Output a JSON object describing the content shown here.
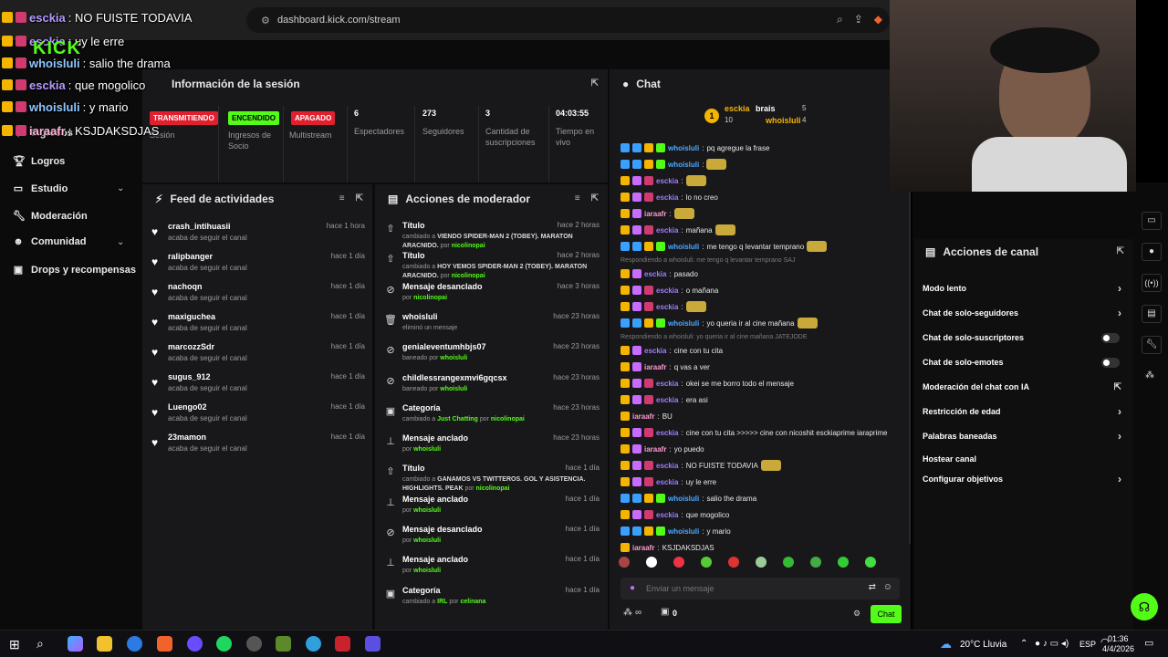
{
  "browser": {
    "url": "dashboard.kick.com/stream"
  },
  "overlay": {
    "lines": [
      {
        "user": "esckia",
        "text": ": NO FUISTE TODAVIA"
      },
      {
        "user": "esckia",
        "text": ": uy le erre"
      },
      {
        "user": "whoisluli",
        "text": ": salio the drama"
      },
      {
        "user": "esckia",
        "text": ": que mogolico"
      },
      {
        "user": "whoisluli",
        "text": ": y mario"
      },
      {
        "user": "iaraafr",
        "text": ": KSJDAKSDJAS"
      }
    ],
    "logo": "KICK"
  },
  "sidebar": {
    "items": [
      {
        "label": "Ingresos",
        "icon": "dollar-icon"
      },
      {
        "label": "Logros",
        "icon": "trophy-icon"
      },
      {
        "label": "Estudio",
        "icon": "studio-icon"
      },
      {
        "label": "Moderación",
        "icon": "wrench-icon"
      },
      {
        "label": "Comunidad",
        "icon": "people-icon"
      },
      {
        "label": "Drops y recompensas",
        "icon": "gift-icon"
      }
    ]
  },
  "session": {
    "title": "Información de la sesión",
    "stats": [
      {
        "badge": "TRANSMITIENDO",
        "label": "Sesión"
      },
      {
        "badge": "ENCENDIDO",
        "label": "Ingresos de Socio"
      },
      {
        "badge": "APAGADO",
        "label": "Multistream"
      },
      {
        "value": "6",
        "label": "Espectadores"
      },
      {
        "value": "273",
        "label": "Seguidores"
      },
      {
        "value": "3",
        "label": "Cantidad de suscripciones"
      },
      {
        "value": "04:03:55",
        "label": "Tiempo en vivo"
      }
    ]
  },
  "feed": {
    "title": "Feed de actividades",
    "items": [
      {
        "name": "crash_intihuasii",
        "sub": "acaba de seguir el canal",
        "time": "hace 1 hora"
      },
      {
        "name": "ralipbanger",
        "sub": "acaba de seguir el canal",
        "time": "hace 1 día"
      },
      {
        "name": "nachoqn",
        "sub": "acaba de seguir el canal",
        "time": "hace 1 día"
      },
      {
        "name": "maxiguchea",
        "sub": "acaba de seguir el canal",
        "time": "hace 1 día"
      },
      {
        "name": "marcozzSdr",
        "sub": "acaba de seguir el canal",
        "time": "hace 1 día"
      },
      {
        "name": "sugus_912",
        "sub": "acaba de seguir el canal",
        "time": "hace 1 día"
      },
      {
        "name": "Luengo02",
        "sub": "acaba de seguir el canal",
        "time": "hace 1 día"
      },
      {
        "name": "23mamon",
        "sub": "acaba de seguir el canal",
        "time": "hace 1 día"
      }
    ]
  },
  "modactions": {
    "title": "Acciones de moderador",
    "items": [
      {
        "icon": "title-icon",
        "name": "Título",
        "pre": "cambiado a ",
        "bold": "VIENDO SPIDER-MAN 2 (TOBEY). MARATON ARACNIDO.",
        "mid": " por ",
        "user": "nicolinopai",
        "time": "hace 2 horas"
      },
      {
        "icon": "title-icon",
        "name": "Título",
        "pre": "cambiado a ",
        "bold": "HOY VEMOS SPIDER-MAN 2 (TOBEY). MARATON ARACNIDO.",
        "mid": " por ",
        "user": "nicolinopai",
        "time": "hace 2 horas"
      },
      {
        "icon": "unpin-icon",
        "name": "Mensaje desanclado",
        "pre": "por ",
        "bold": "",
        "mid": "",
        "user": "nicolinopai",
        "time": "hace 3 horas"
      },
      {
        "icon": "trash-icon",
        "name": "whoisluli",
        "pre": "eliminó un mensaje",
        "bold": "",
        "mid": "",
        "user": "",
        "time": "hace 23 horas"
      },
      {
        "icon": "ban-icon",
        "name": "genialeventumhbjs07",
        "pre": "baneado por ",
        "bold": "",
        "mid": "",
        "user": "whoisluli",
        "time": "hace 23 horas"
      },
      {
        "icon": "ban-icon",
        "name": "childlessrangexmvi6gqcsx",
        "pre": "baneado por ",
        "bold": "",
        "mid": "",
        "user": "whoisluli",
        "time": "hace 23 horas"
      },
      {
        "icon": "category-icon",
        "name": "Categoría",
        "pre": "cambiado a ",
        "bold": "",
        "mid": " por ",
        "user": "nicolinopai",
        "green": "Just Chatting",
        "time": "hace 23 horas"
      },
      {
        "icon": "pin-icon",
        "name": "Mensaje anclado",
        "pre": "por ",
        "bold": "",
        "mid": "",
        "user": "whoisluli",
        "time": "hace 23 horas"
      },
      {
        "icon": "title-icon",
        "name": "Título",
        "pre": "cambiado a ",
        "bold": "GANAMOS VS TWITTEROS. GOL Y ASISTENCIA. HIGHLIGHTS. PEAK",
        "mid": " por ",
        "user": "nicolinopai",
        "time": "hace 1 día"
      },
      {
        "icon": "pin-icon",
        "name": "Mensaje anclado",
        "pre": "por ",
        "bold": "",
        "mid": "",
        "user": "whoisluli",
        "time": "hace 1 día"
      },
      {
        "icon": "unpin-icon",
        "name": "Mensaje desanclado",
        "pre": "por ",
        "bold": "",
        "mid": "",
        "user": "whoisluli",
        "time": "hace 1 día"
      },
      {
        "icon": "pin-icon",
        "name": "Mensaje anclado",
        "pre": "por ",
        "bold": "",
        "mid": "",
        "user": "whoisluli",
        "time": "hace 1 día"
      },
      {
        "icon": "category-icon",
        "name": "Categoría",
        "pre": "cambiado a ",
        "bold": "",
        "mid": " por ",
        "user": "celinana",
        "green": "IRL",
        "time": "hace 1 día"
      }
    ]
  },
  "chat": {
    "title": "Chat",
    "top": [
      {
        "rank": "1",
        "user": "esckia",
        "count": "10"
      },
      {
        "user": "brais",
        "count": "5"
      },
      {
        "user": "whoisluli",
        "count": "4"
      }
    ],
    "messages": [
      {
        "user": "whoisluli",
        "ucolor": "#4aa8ff",
        "text": "pq agregue la frase",
        "badges": [
          "#3aa0ff",
          "#3aa0ff",
          "#f5b400",
          "#53fc18"
        ]
      },
      {
        "user": "whoisluli",
        "ucolor": "#4aa8ff",
        "text": "",
        "badges": [
          "#3aa0ff",
          "#3aa0ff",
          "#f5b400",
          "#53fc18"
        ],
        "emote": true
      },
      {
        "user": "esckia",
        "ucolor": "#a07cff",
        "text": "",
        "badges": [
          "#f5b400",
          "#c86bff",
          "#d03a6f"
        ],
        "emote": true
      },
      {
        "user": "esckia",
        "ucolor": "#a07cff",
        "text": "lo no creo",
        "badges": [
          "#f5b400",
          "#c86bff",
          "#d03a6f"
        ]
      },
      {
        "user": "iaraafr",
        "ucolor": "#ff9bd0",
        "text": "",
        "badges": [
          "#f5b400",
          "#c86bff"
        ],
        "emote": true
      },
      {
        "user": "esckia",
        "ucolor": "#a07cff",
        "text": "mañana",
        "badges": [
          "#f5b400",
          "#c86bff",
          "#d03a6f"
        ],
        "emote": true
      },
      {
        "user": "whoisluli",
        "ucolor": "#4aa8ff",
        "text": "me tengo q levantar temprano",
        "badges": [
          "#3aa0ff",
          "#3aa0ff",
          "#f5b400",
          "#53fc18"
        ],
        "emote": true
      },
      {
        "reply": "Respondiendo a whoisluli: me tengo q levantar temprano SAJ"
      },
      {
        "user": "esckia",
        "ucolor": "#a07cff",
        "text": "pasado",
        "badges": [
          "#f5b400",
          "#c86bff"
        ]
      },
      {
        "user": "esckia",
        "ucolor": "#a07cff",
        "text": "o mañana",
        "badges": [
          "#f5b400",
          "#c86bff",
          "#d03a6f"
        ]
      },
      {
        "user": "esckia",
        "ucolor": "#a07cff",
        "text": "",
        "badges": [
          "#f5b400",
          "#c86bff",
          "#d03a6f"
        ],
        "emote": true
      },
      {
        "user": "whoisluli",
        "ucolor": "#4aa8ff",
        "text": "yo queria ir al cine mañana",
        "badges": [
          "#3aa0ff",
          "#3aa0ff",
          "#f5b400",
          "#53fc18"
        ],
        "emote": true
      },
      {
        "reply": "Respondiendo a whoisluli: yo queria ir al cine mañana JATEJODE"
      },
      {
        "user": "esckia",
        "ucolor": "#a07cff",
        "text": "cine con tu cita",
        "badges": [
          "#f5b400",
          "#c86bff"
        ]
      },
      {
        "user": "iaraafr",
        "ucolor": "#ff9bd0",
        "text": "q vas a ver",
        "badges": [
          "#f5b400",
          "#c86bff"
        ]
      },
      {
        "user": "esckia",
        "ucolor": "#a07cff",
        "text": "okei se me borro todo el mensaje",
        "badges": [
          "#f5b400",
          "#c86bff",
          "#d03a6f"
        ]
      },
      {
        "user": "esckia",
        "ucolor": "#a07cff",
        "text": "era asi",
        "badges": [
          "#f5b400",
          "#c86bff",
          "#d03a6f"
        ]
      },
      {
        "user": "iaraafr",
        "ucolor": "#ff9bd0",
        "text": "BU",
        "badges": [
          "#f5b400"
        ]
      },
      {
        "user": "esckia",
        "ucolor": "#a07cff",
        "text": "cine con tu cita >>>>> cine con nicoshit esckiaprime iaraprime",
        "badges": [
          "#f5b400",
          "#c86bff",
          "#d03a6f"
        ]
      },
      {
        "user": "iaraafr",
        "ucolor": "#ff9bd0",
        "text": "yo puedo",
        "badges": [
          "#f5b400",
          "#c86bff"
        ]
      },
      {
        "user": "esckia",
        "ucolor": "#a07cff",
        "text": "NO FUISTE TODAVIA",
        "badges": [
          "#f5b400",
          "#c86bff",
          "#d03a6f"
        ],
        "emote": true
      },
      {
        "user": "esckia",
        "ucolor": "#a07cff",
        "text": "uy le erre",
        "badges": [
          "#f5b400",
          "#c86bff",
          "#d03a6f"
        ]
      },
      {
        "user": "whoisluli",
        "ucolor": "#4aa8ff",
        "text": "salio the drama",
        "badges": [
          "#3aa0ff",
          "#3aa0ff",
          "#f5b400",
          "#53fc18"
        ]
      },
      {
        "user": "esckia",
        "ucolor": "#a07cff",
        "text": "que mogolico",
        "badges": [
          "#f5b400",
          "#c86bff",
          "#d03a6f"
        ]
      },
      {
        "user": "whoisluli",
        "ucolor": "#4aa8ff",
        "text": "y mario",
        "badges": [
          "#3aa0ff",
          "#3aa0ff",
          "#f5b400",
          "#53fc18"
        ]
      },
      {
        "user": "iaraafr",
        "ucolor": "#ff9bd0",
        "text": "KSJDAKSDJAS",
        "badges": [
          "#f5b400"
        ]
      }
    ],
    "input_placeholder": "Enviar un mensaje",
    "points": "0",
    "send_label": "Chat"
  },
  "channel_actions": {
    "title": "Acciones de canal",
    "items": [
      {
        "label": "Modo lento",
        "control": "chevron"
      },
      {
        "label": "Chat de solo-seguidores",
        "control": "chevron"
      },
      {
        "label": "Chat de solo-suscriptores",
        "control": "toggle"
      },
      {
        "label": "Chat de solo-emotes",
        "control": "toggle"
      },
      {
        "label": "Moderación del chat con IA",
        "control": "external"
      },
      {
        "label": "Restricción de edad",
        "control": "chevron"
      },
      {
        "label": "Palabras baneadas",
        "control": "chevron"
      },
      {
        "label": "Hostear canal",
        "control": "none"
      },
      {
        "label": "Configurar objetivos",
        "control": "chevron"
      }
    ]
  },
  "taskbar": {
    "weather": "20°C  Lluvia",
    "lang": "ESP",
    "time": "01:36",
    "date": "4/4/2026"
  },
  "colors": {
    "kick_green": "#53fc18",
    "live_red": "#e0202f"
  }
}
